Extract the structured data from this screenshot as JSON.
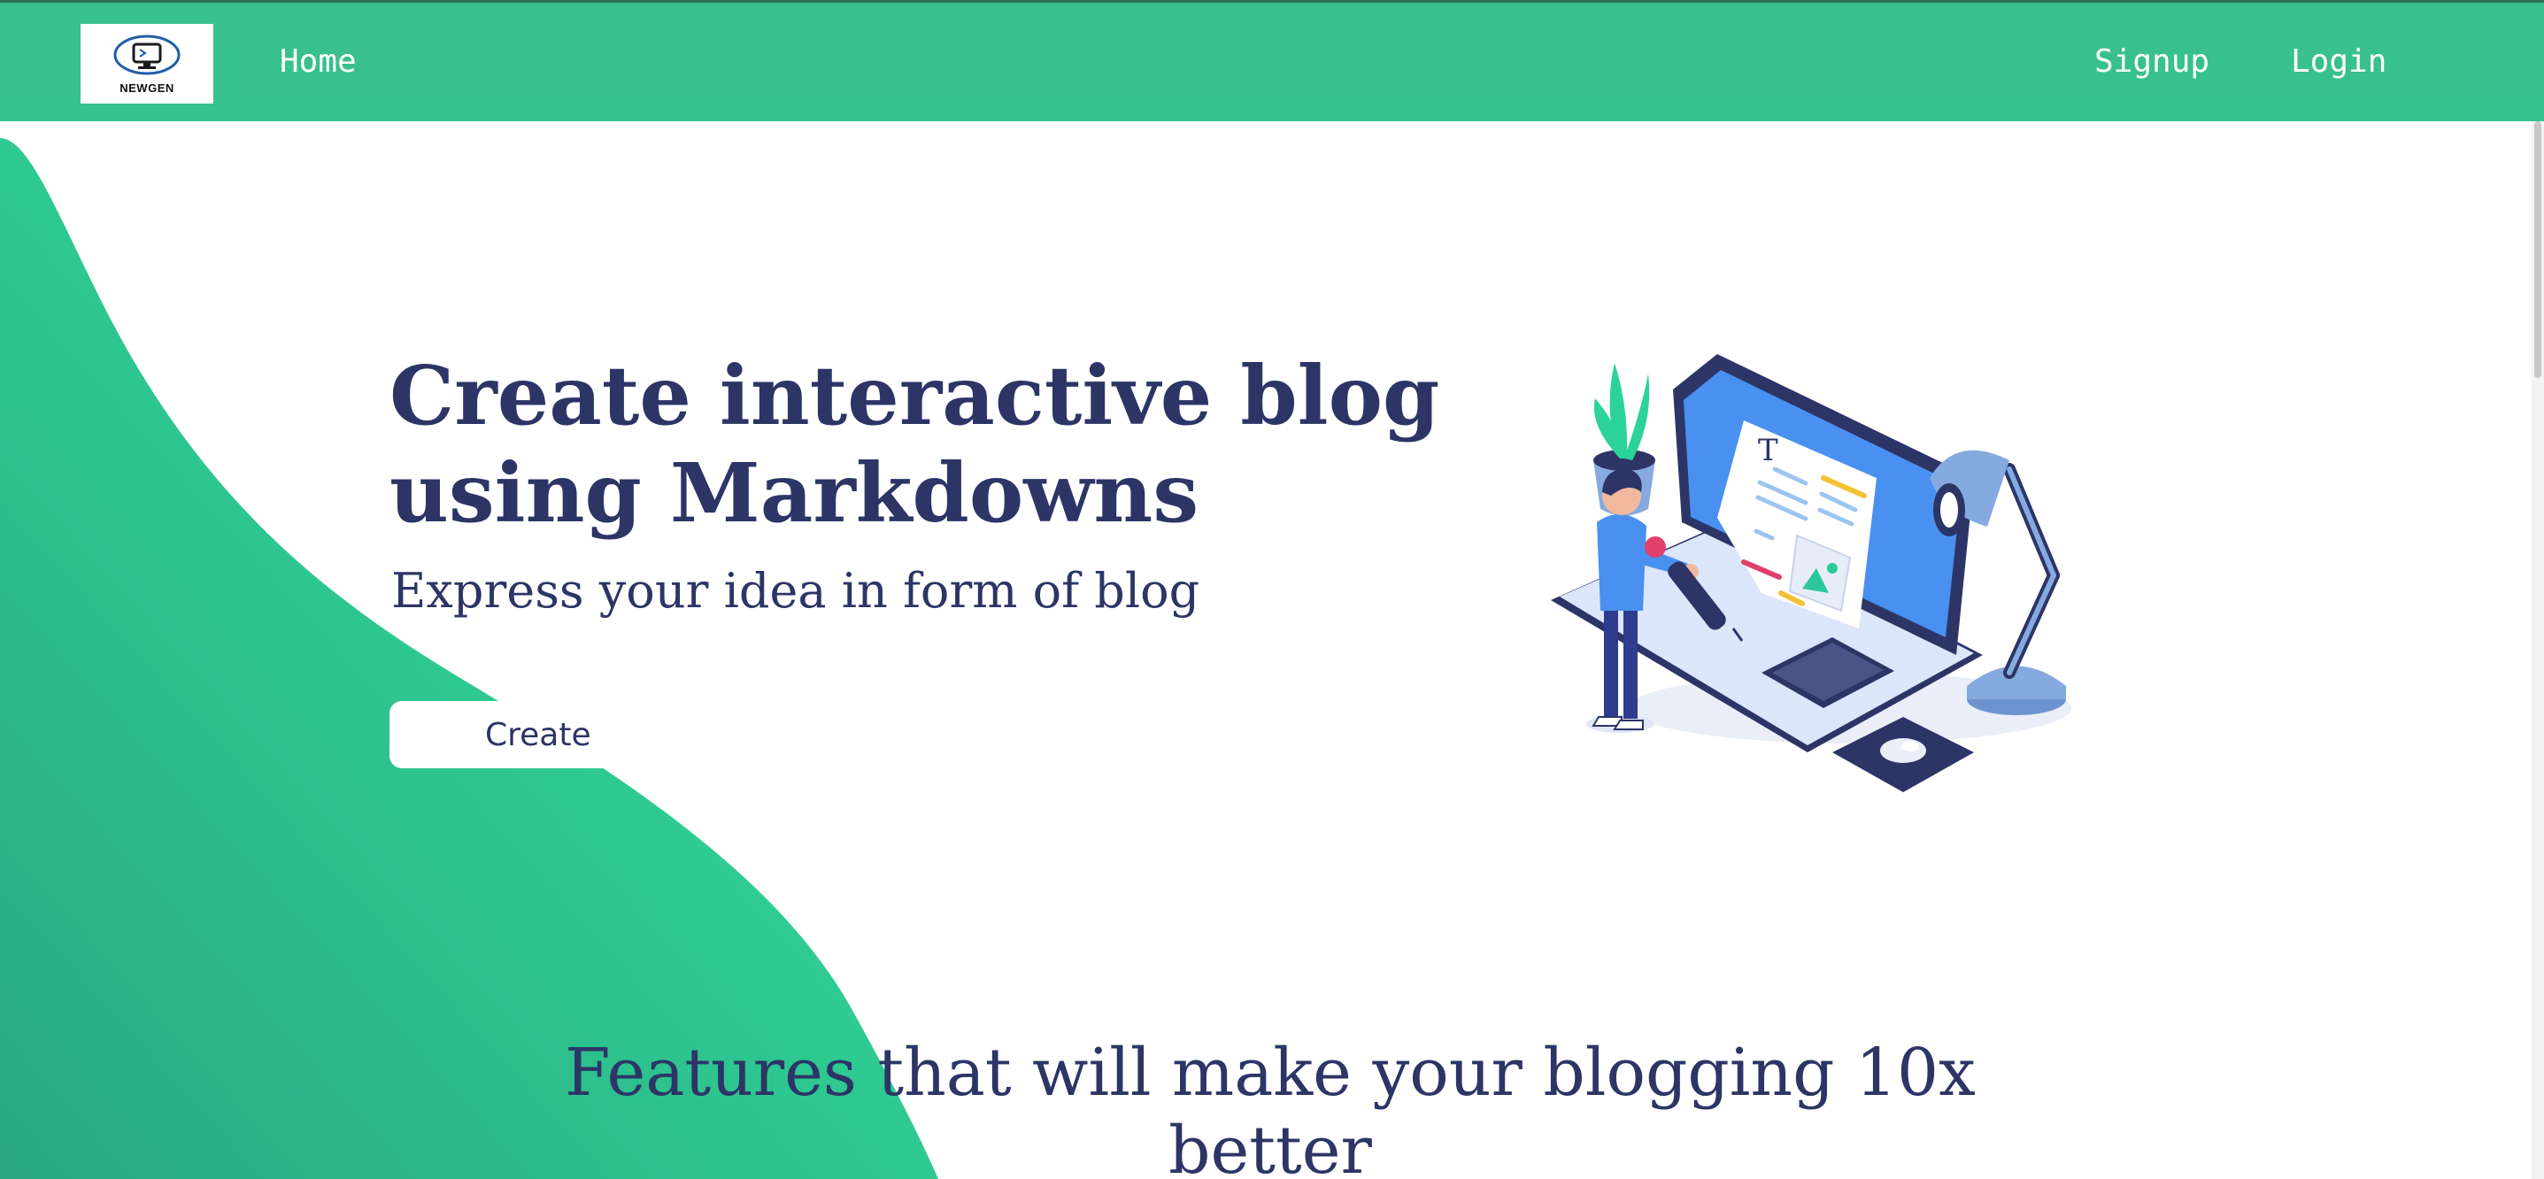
{
  "navbar": {
    "logo_text": "NEWGEN",
    "links": {
      "home": "Home",
      "signup": "Signup",
      "login": "Login"
    },
    "background_color": "#36c08f"
  },
  "hero": {
    "title": "Create interactive blog using Markdowns",
    "subtitle": "Express your idea in form of blog",
    "cta_label": "Create",
    "illustration_icon": "person-writing-blog-laptop-illustration"
  },
  "features": {
    "title": "Features that will make your blogging 10x better"
  },
  "colors": {
    "brand_green": "#35c28f",
    "text_navy": "#2c3566"
  }
}
